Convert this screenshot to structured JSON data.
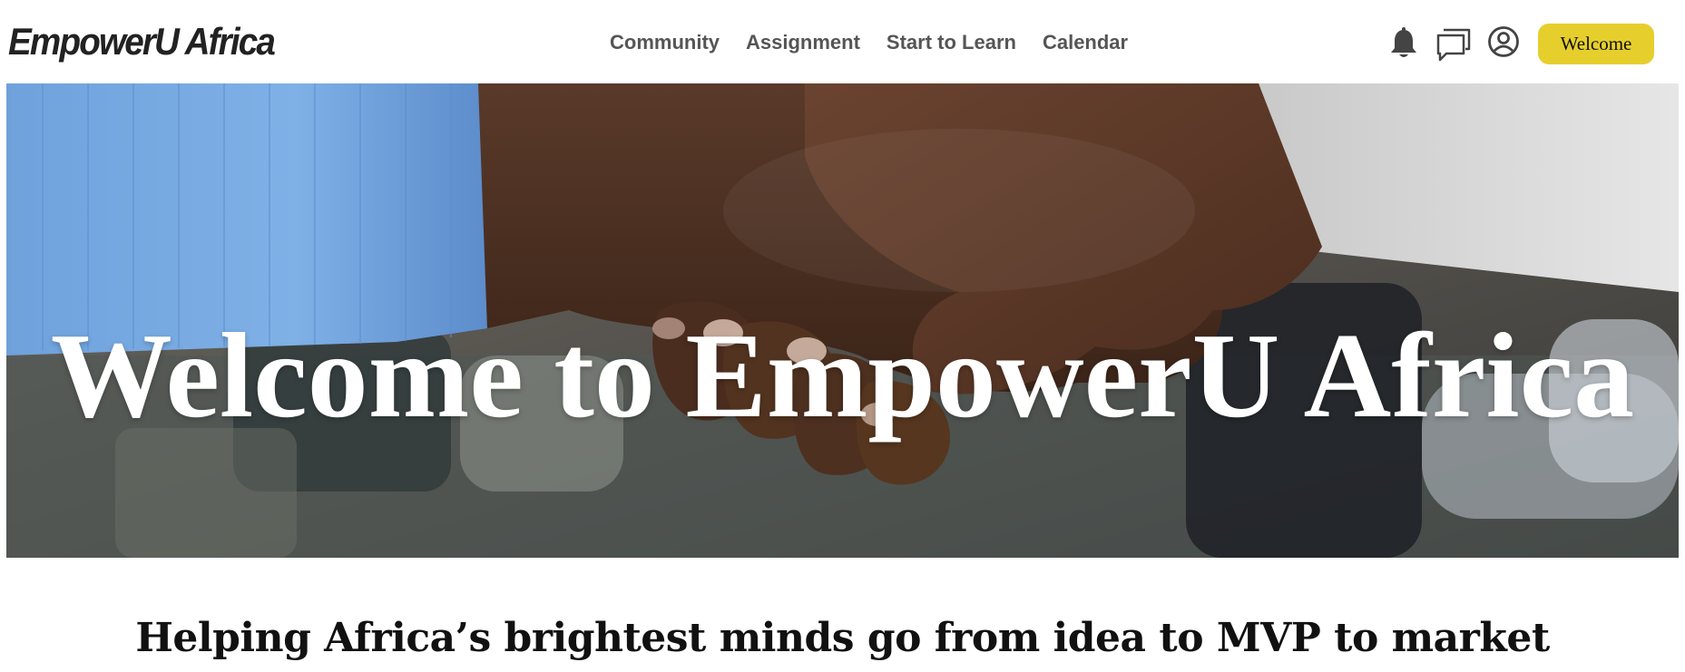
{
  "header": {
    "logo": "EmpowerU Africa",
    "nav": [
      "Community",
      "Assignment",
      "Start to Learn",
      "Calendar"
    ],
    "icons": [
      "bell-icon",
      "chat-icon",
      "user-icon"
    ],
    "welcome_button": "Welcome"
  },
  "hero": {
    "title": "Welcome to EmpowerU Africa",
    "image": "handshake-photo"
  },
  "tagline": "Helping Africa’s brightest minds go from idea to MVP to market",
  "colors": {
    "accent": "#e6cf2c",
    "nav_text": "#555555",
    "logo_text": "#222222"
  }
}
